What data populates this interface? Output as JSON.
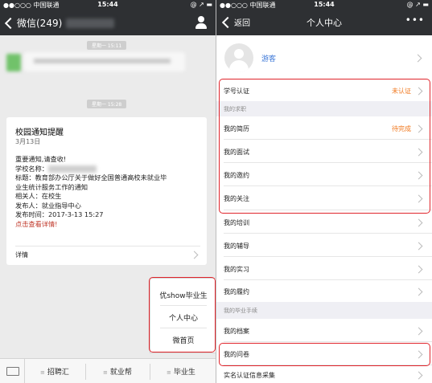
{
  "left_screen": {
    "status": {
      "carrier": "●●○○○ 中国联通",
      "time": "15:44",
      "battery": "@ ↗ ▬"
    },
    "nav": {
      "back_label": "微信(249)"
    },
    "timestamps": [
      "星期一 15:11",
      "星期一 15:28"
    ],
    "card": {
      "title": "校园通知提醒",
      "date": "3月13日",
      "lines": [
        "重要通知,请查收!",
        "学校名称：",
        "标题：教育部办公厅关于做好全国普通高校未就业毕",
        "业生统计服务工作的通知",
        "相关人：在校生",
        "发布人：就业指导中心",
        "发布时间：2017-3-13 15:27"
      ],
      "link": "点击查看详情!",
      "detail_label": "详情"
    },
    "popup_menu": [
      "优show毕业生",
      "个人中心",
      "微首页"
    ],
    "bottom_menu": [
      "招聘汇",
      "就业帮",
      "毕业生"
    ]
  },
  "right_screen": {
    "status": {
      "carrier": "●●○○○ 中国联通",
      "time": "15:44",
      "battery": "@ ↗ ▬"
    },
    "nav": {
      "back_label": "返回",
      "title": "个人中心",
      "more_label": "•••"
    },
    "profile": {
      "name": "游客"
    },
    "student_auth": {
      "label": "学号认证",
      "status": "未认证"
    },
    "section_job": "我的求职",
    "job_items": [
      {
        "label": "我的简历",
        "status": "待完成"
      },
      {
        "label": "我的面试",
        "status": ""
      },
      {
        "label": "我的邀约",
        "status": ""
      },
      {
        "label": "我的关注",
        "status": ""
      },
      {
        "label": "我的培训",
        "status": ""
      },
      {
        "label": "我的辅导",
        "status": ""
      },
      {
        "label": "我的实习",
        "status": ""
      },
      {
        "label": "我的履约",
        "status": ""
      }
    ],
    "section_grad": "我的毕业手续",
    "grad_items": [
      {
        "label": "我的档案"
      },
      {
        "label": "我的问卷"
      },
      {
        "label": "实名认证信息采集"
      }
    ]
  },
  "colors": {
    "nav_bg": "#2e3033",
    "highlight": "#e0242b",
    "status_orange": "#f0781e",
    "link_red": "#c0392b",
    "name_blue": "#3d78d8"
  }
}
